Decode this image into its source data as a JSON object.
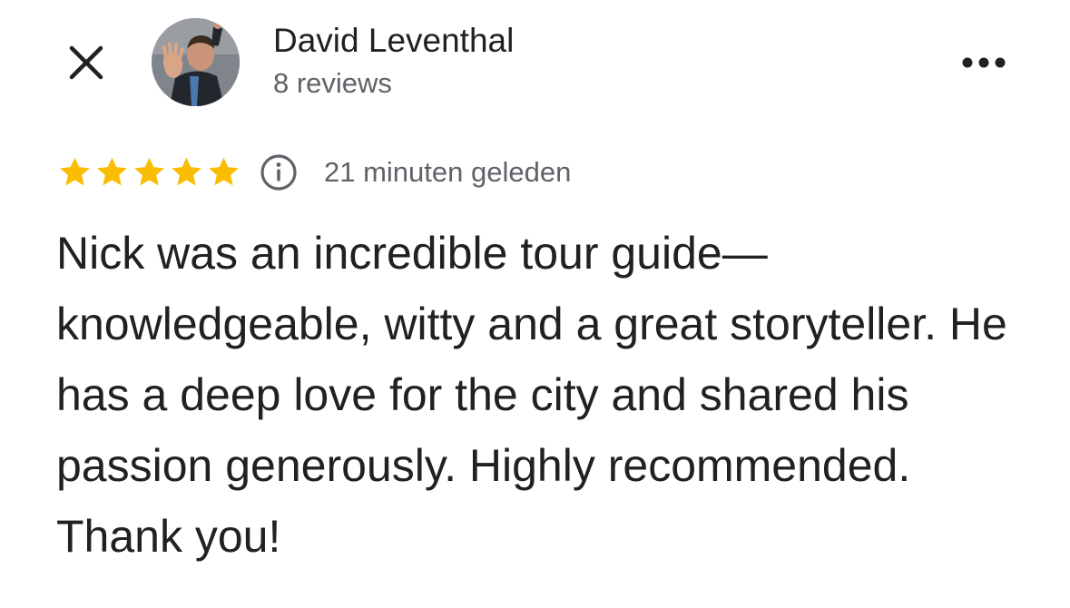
{
  "header": {
    "close_icon": "close-icon",
    "more_icon": "more-horizontal-icon",
    "author": {
      "name": "David Leventhal",
      "meta": "8 reviews",
      "avatar": "profile-photo"
    }
  },
  "review": {
    "rating": 5,
    "rating_max": 5,
    "star_color": "#fbbc04",
    "info_icon": "info-icon",
    "time_ago": "21 minuten geleden",
    "text": "Nick was an incredible tour guide—knowledgeable, witty and a great storyteller. He has a deep love for the city and shared his passion generously. Highly recommended. Thank you!"
  }
}
